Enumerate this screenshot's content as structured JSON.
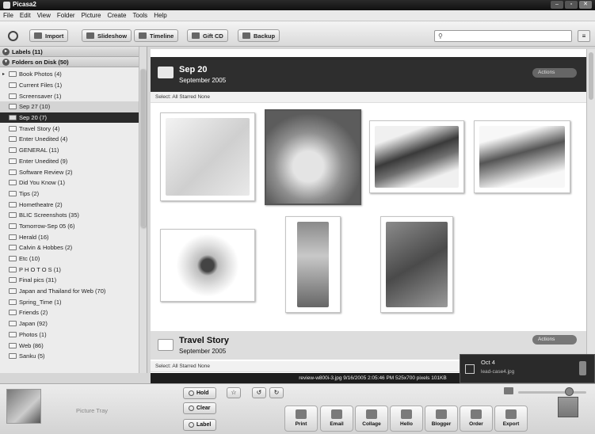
{
  "window": {
    "title": "Picasa2"
  },
  "menu": [
    "File",
    "Edit",
    "View",
    "Folder",
    "Picture",
    "Create",
    "Tools",
    "Help"
  ],
  "toolbar": {
    "import": "Import",
    "slideshow": "Slideshow",
    "timeline": "Timeline",
    "giftcd": "Gift CD",
    "backup": "Backup"
  },
  "sidebar": {
    "labels_header": "Labels (11)",
    "folders_header": "Folders on Disk (50)",
    "folders": [
      "Book Photos (4)",
      "Current Files (1)",
      "Screensaver (1)",
      "Sep 27 (10)",
      "Sep 20 (7)",
      "Travel Story (4)",
      "Enter Unedited (4)",
      "GENERAL (11)",
      "Enter Unedited (9)",
      "Software Review (2)",
      "Did You Know (1)",
      "Tips (2)",
      "Hometheatre (2)",
      "BLIC Screenshots (35)",
      "Tomorrow-Sep 05 (6)",
      "Herald (16)",
      "Calvin & Hobbes (2)",
      "Etc (10)",
      "P H O T O S (1)",
      "Final pics (31)",
      "Japan and Thailand for Web (70)",
      "Spring_Time (1)",
      "Friends (2)",
      "Japan (92)",
      "Photos (1)",
      "Web (86)",
      "Sanku (5)"
    ]
  },
  "group1": {
    "title": "Sep 20",
    "date": "September 2005",
    "actions": "Actions",
    "select": "Select:  All  Starred  None"
  },
  "group2": {
    "title": "Travel Story",
    "date": "September 2005",
    "actions": "Actions",
    "select": "Select:  All  Starred  None"
  },
  "status": "review-w800i-3.jpg    9/16/2005 2:05:46 PM    525x700 pixels    101KB",
  "popup": {
    "date": "Oct 4",
    "file": "lead-case4.jpg"
  },
  "tray": {
    "label": "Picture Tray",
    "hold": "Hold",
    "clear": "Clear",
    "tag": "Label"
  },
  "share": [
    "Print",
    "Email",
    "Collage",
    "Hello",
    "Blogger",
    "Order",
    "Export"
  ]
}
